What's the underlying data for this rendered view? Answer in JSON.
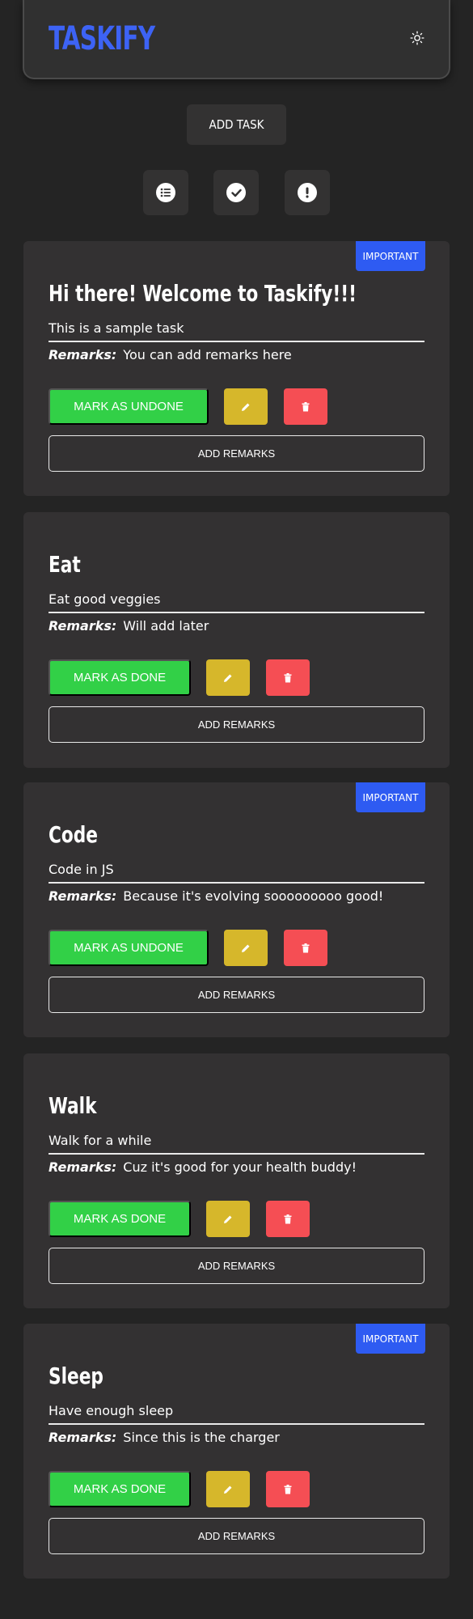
{
  "header": {
    "logo": "TASKIFY",
    "theme_icon": "sun-icon"
  },
  "toolbar": {
    "add_task_label": "ADD TASK"
  },
  "filters": [
    {
      "name": "all",
      "icon": "list-icon"
    },
    {
      "name": "done",
      "icon": "check-icon"
    },
    {
      "name": "important",
      "icon": "exclamation-icon"
    }
  ],
  "tasks": [
    {
      "important": true,
      "badge": "IMPORTANT",
      "title": "Hi there! Welcome to Taskify!!!",
      "description": "This is a sample task",
      "remarks_label": "Remarks:",
      "remarks": "You can add remarks here",
      "toggle_label": "MARK AS UNDONE",
      "add_remarks_label": "ADD REMARKS"
    },
    {
      "important": false,
      "badge": "",
      "title": "Eat",
      "description": "Eat good veggies",
      "remarks_label": "Remarks:",
      "remarks": "Will add later",
      "toggle_label": "MARK AS DONE",
      "add_remarks_label": "ADD REMARKS"
    },
    {
      "important": true,
      "badge": "IMPORTANT",
      "title": "Code",
      "description": "Code in JS",
      "remarks_label": "Remarks:",
      "remarks": "Because it's evolving sooooooooo good!",
      "toggle_label": "MARK AS UNDONE",
      "add_remarks_label": "ADD REMARKS"
    },
    {
      "important": false,
      "badge": "",
      "title": "Walk",
      "description": "Walk for a while",
      "remarks_label": "Remarks:",
      "remarks": "Cuz it's good for your health buddy!",
      "toggle_label": "MARK AS DONE",
      "add_remarks_label": "ADD REMARKS"
    },
    {
      "important": true,
      "badge": "IMPORTANT",
      "title": "Sleep",
      "description": "Have enough sleep",
      "remarks_label": "Remarks:",
      "remarks": "Since this is the charger",
      "toggle_label": "MARK AS DONE",
      "add_remarks_label": "ADD REMARKS"
    }
  ],
  "colors": {
    "background": "#242424",
    "card": "#333132",
    "logo": "#3d63f5",
    "badge": "#2e5bf2",
    "done_button": "#32d047",
    "edit_button": "#d6b72b",
    "delete_button": "#f54e54"
  }
}
